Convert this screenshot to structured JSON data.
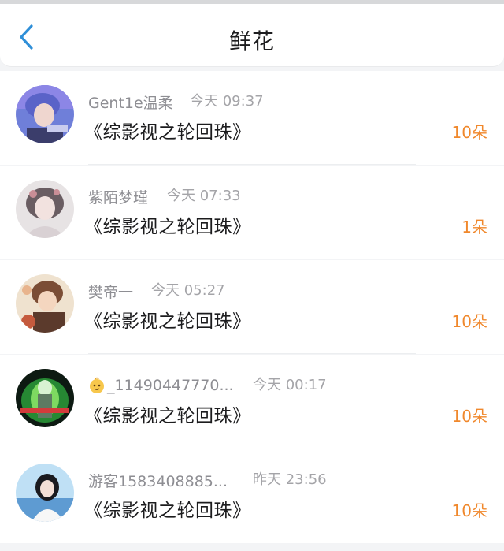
{
  "header": {
    "title": "鲜花",
    "back_icon": "chevron-left-icon",
    "accent_color": "#2f8fd8"
  },
  "list": {
    "items": [
      {
        "name": "Gent1e温柔",
        "time": "今天 09:37",
        "book": "《综影视之轮回珠》",
        "count": "10朵"
      },
      {
        "name": "紫陌梦瑾",
        "time": "今天 07:33",
        "book": "《综影视之轮回珠》",
        "count": "1朵"
      },
      {
        "name": "樊帝一",
        "time": "今天 05:27",
        "book": "《综影视之轮回珠》",
        "count": "10朵"
      },
      {
        "name": "_11490447770...",
        "time": "今天 00:17",
        "book": "《综影视之轮回珠》",
        "count": "10朵",
        "name_icon": "baby-emoji-icon"
      },
      {
        "name": "游客1583408885...",
        "time": "昨天 23:56",
        "book": "《综影视之轮回珠》",
        "count": "10朵"
      }
    ]
  },
  "colors": {
    "count": "#f0882c",
    "background": "#f3f4f6"
  }
}
